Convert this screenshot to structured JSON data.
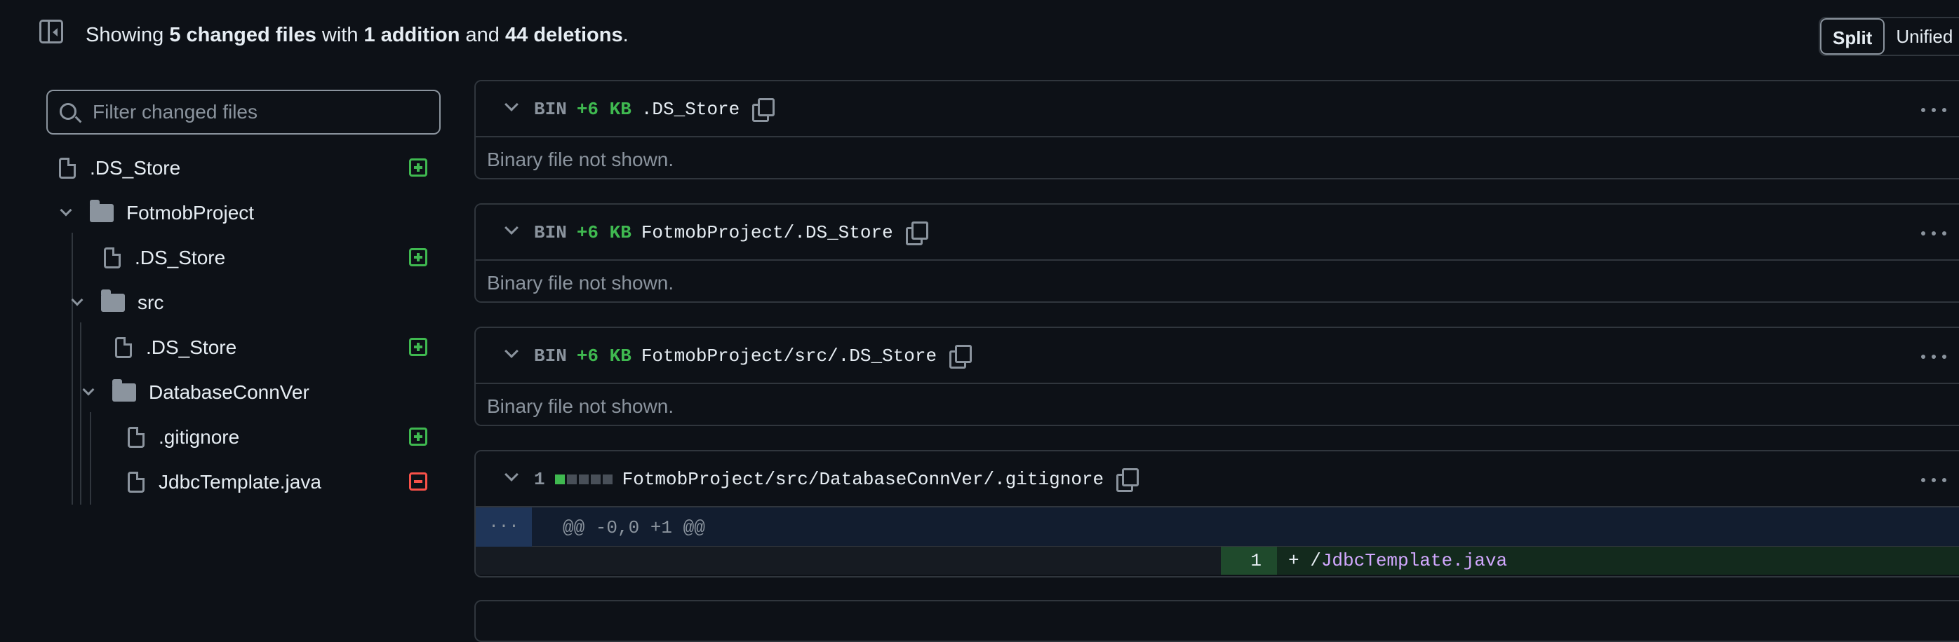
{
  "summary": {
    "prefix": "Showing",
    "changed_files": "5 changed files",
    "with": "with",
    "additions": "1 addition",
    "and": "and",
    "deletions": "44 deletions",
    "suffix": "."
  },
  "view_toggle": {
    "split": "Split",
    "unified": "Unified",
    "selected": "Split"
  },
  "filter": {
    "placeholder": "Filter changed files",
    "value": ""
  },
  "tree": [
    {
      "type": "file",
      "name": ".DS_Store",
      "status": "added"
    },
    {
      "type": "folder",
      "name": "FotmobProject",
      "expanded": true
    },
    {
      "type": "file",
      "name": ".DS_Store",
      "status": "added"
    },
    {
      "type": "folder",
      "name": "src",
      "expanded": true
    },
    {
      "type": "file",
      "name": ".DS_Store",
      "status": "added"
    },
    {
      "type": "folder",
      "name": "DatabaseConnVer",
      "expanded": true
    },
    {
      "type": "file",
      "name": ".gitignore",
      "status": "added"
    },
    {
      "type": "file",
      "name": "JdbcTemplate.java",
      "status": "deleted"
    }
  ],
  "diffs": [
    {
      "kind": "BIN",
      "size": "+6 KB",
      "path": ".DS_Store",
      "body": "Binary file not shown."
    },
    {
      "kind": "BIN",
      "size": "+6 KB",
      "path": "FotmobProject/.DS_Store",
      "body": "Binary file not shown."
    },
    {
      "kind": "BIN",
      "size": "+6 KB",
      "path": "FotmobProject/src/.DS_Store",
      "body": "Binary file not shown."
    },
    {
      "count": "1",
      "path": "FotmobProject/src/DatabaseConnVer/.gitignore",
      "expand": "...",
      "hunk": "@@ -0,0 +1 @@",
      "line_number": "1",
      "line_prefix": "+ /",
      "line_content": "JdbcTemplate.java"
    }
  ],
  "colors": {
    "background": "#0d1117",
    "border": "#30363d",
    "added": "#3fb950",
    "deleted": "#f85149",
    "muted": "#8b949e"
  }
}
